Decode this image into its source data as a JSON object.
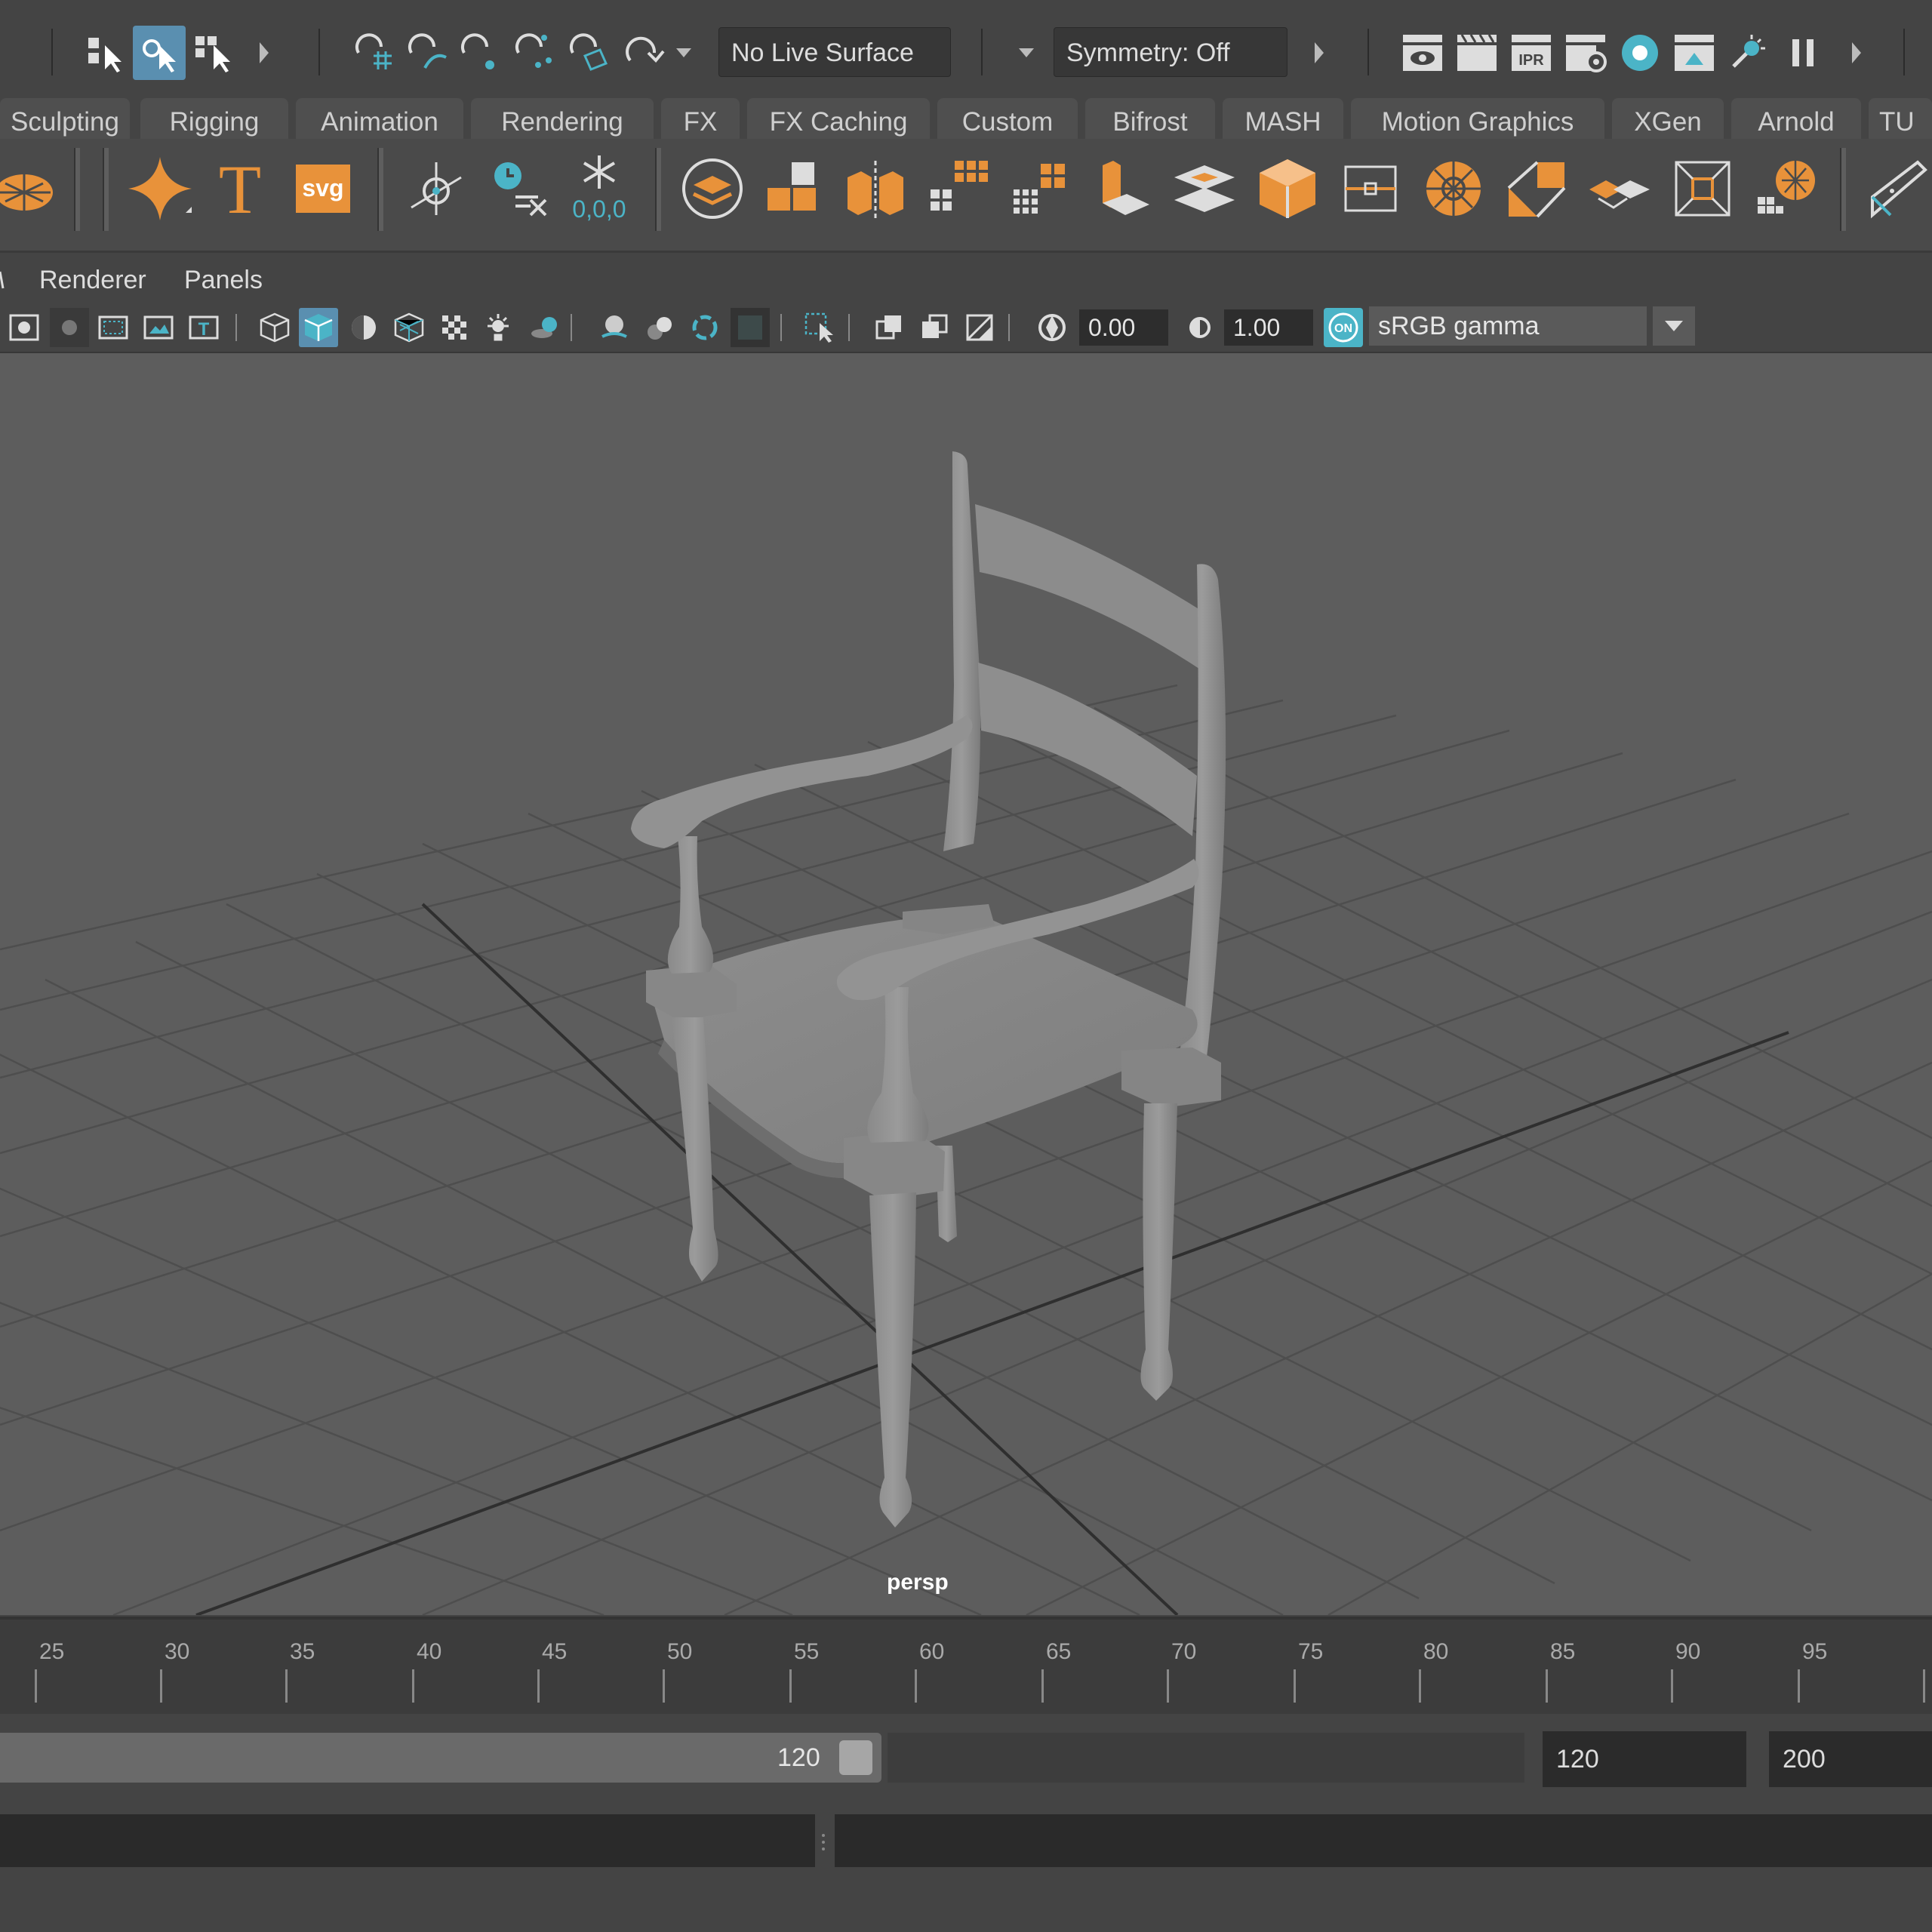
{
  "status_line": {
    "live_surface": "No Live Surface",
    "symmetry": "Symmetry: Off"
  },
  "shelf_tabs": [
    "Sculpting",
    "Rigging",
    "Animation",
    "Rendering",
    "FX",
    "FX Caching",
    "Custom",
    "Bifrost",
    "MASH",
    "Motion Graphics",
    "XGen",
    "Arnold",
    "TU"
  ],
  "shelf": {
    "text_icon_letter": "T",
    "svg_icon_label": "svg",
    "snowflake_readout": "0,0,0"
  },
  "panel_menu": {
    "renderer": "Renderer",
    "panels": "Panels"
  },
  "panel_toolbar": {
    "exposure": "0.00",
    "gamma": "1.00",
    "color_mgmt_badge": "ON",
    "view_transform": "sRGB gamma"
  },
  "viewport": {
    "camera": "persp"
  },
  "timeline": {
    "ticks": [
      "25",
      "30",
      "35",
      "40",
      "45",
      "50",
      "55",
      "60",
      "65",
      "70",
      "75",
      "80",
      "85",
      "90",
      "95"
    ]
  },
  "range": {
    "slider_end": "120",
    "end_time": "120",
    "anim_end": "200"
  },
  "colors": {
    "accent_blue": "#5a8fb0",
    "icon_orange": "#e8923a",
    "icon_teal": "#4bb4c7"
  }
}
